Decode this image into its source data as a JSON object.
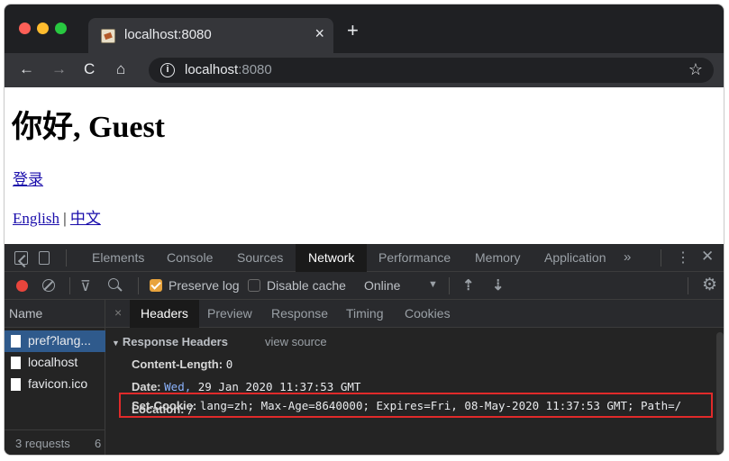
{
  "browser": {
    "tab_title": "localhost:8080",
    "tab_close": "×",
    "new_tab": "+",
    "nav": {
      "back": "←",
      "forward": "→",
      "reload": "C",
      "home": "⌂"
    },
    "url_host": "localhost",
    "url_port": ":8080",
    "info_icon": "i",
    "star": "☆"
  },
  "page": {
    "greeting": "你好, Guest",
    "login_link": "登录",
    "lang_english": "English",
    "lang_sep": " | ",
    "lang_chinese": "中文"
  },
  "devtools": {
    "tabs": [
      "Elements",
      "Console",
      "Sources",
      "Network",
      "Performance",
      "Memory",
      "Application"
    ],
    "active_tab": "Network",
    "more": "»",
    "kebab": "⋮",
    "close": "✕",
    "toolbar": {
      "preserve_log": "Preserve log",
      "preserve_log_checked": true,
      "disable_cache": "Disable cache",
      "disable_cache_checked": false,
      "throttle": "Online",
      "throttle_arrow": "▼",
      "filter_icon": "⊽",
      "upload": "⇡",
      "download": "⇣",
      "gear": "⚙"
    },
    "name_header": "Name",
    "requests": [
      {
        "name": "pref?lang...",
        "selected": true
      },
      {
        "name": "localhost",
        "selected": false
      },
      {
        "name": "favicon.ico",
        "selected": false
      }
    ],
    "status": "3 requests",
    "status_extra": "6",
    "detail": {
      "close": "×",
      "tabs": [
        "Headers",
        "Preview",
        "Response",
        "Timing",
        "Cookies"
      ],
      "active_tab": "Headers",
      "section_caret": "▼",
      "section_title": "Response Headers",
      "view_source": "view source",
      "headers": [
        {
          "key": "Content-Length:",
          "value": "0"
        },
        {
          "key": "Date:",
          "value_hl": "Wed,",
          "value": "29 Jan 2020 11:37:53 GMT"
        },
        {
          "key": "Location:",
          "value": "/"
        },
        {
          "key": "Set-Cookie:",
          "value": "lang=zh; Max-Age=8640000; Expires=Fri, 08-May-2020 11:37:53 GMT; Path=/"
        }
      ]
    }
  },
  "colors": {
    "tabstrip_bg": "#1f2023",
    "toolbar_bg": "#35363a",
    "devtools_bg": "#242424",
    "selected_row": "#2f5a8c",
    "highlight_box": "#e02a2a",
    "link": "#1a0dab"
  }
}
